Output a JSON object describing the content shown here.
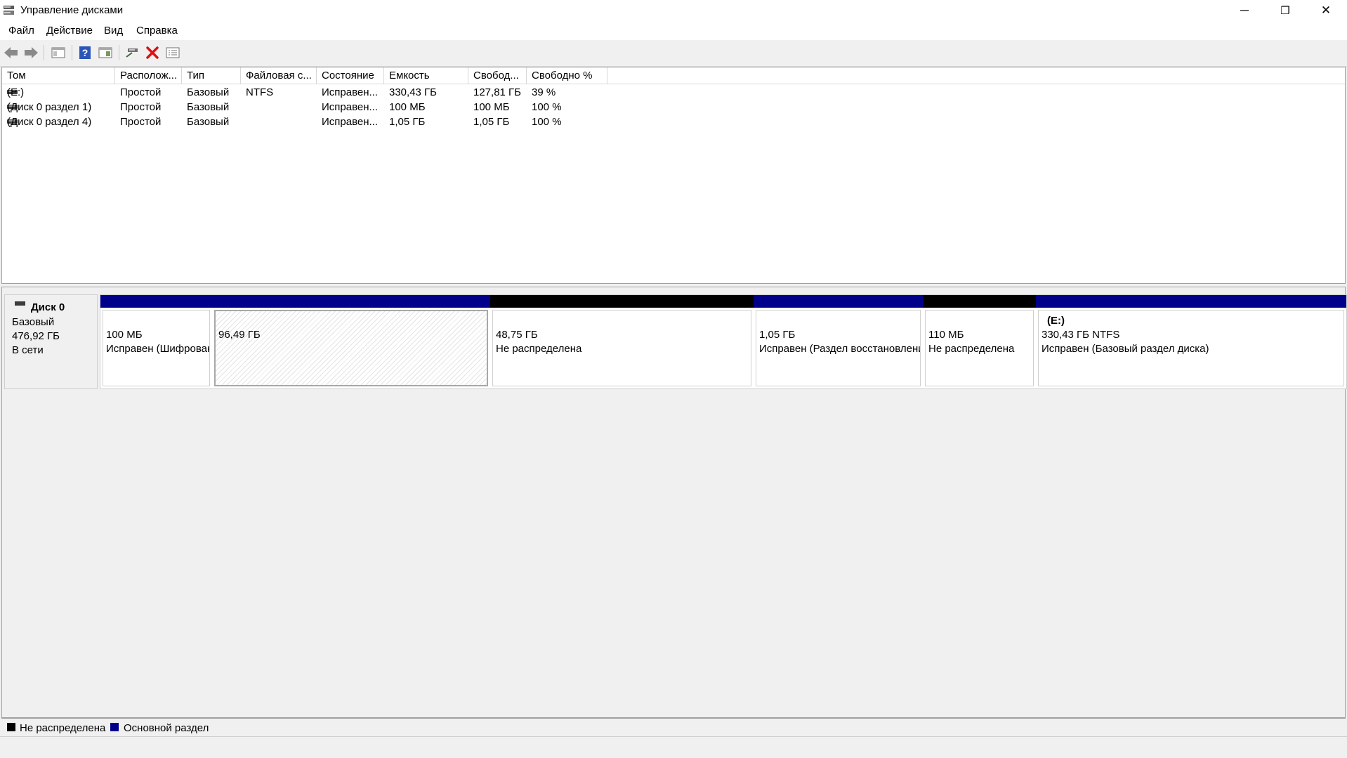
{
  "window": {
    "title": "Управление дисками",
    "minimize_symbol": "─",
    "restore_symbol": "❐",
    "close_symbol": "✕"
  },
  "menu": [
    "Файл",
    "Действие",
    "Вид",
    "Справка"
  ],
  "toolbar": {
    "icons": [
      "back-icon",
      "forward-icon",
      "console-tree-icon",
      "help-icon",
      "properties-view-icon",
      "connect-icon",
      "delete-icon",
      "properties-icon"
    ],
    "delete_color": "#e01010",
    "help_color": "#2c55b8"
  },
  "volume_list": {
    "columns": [
      "Том",
      "Располож...",
      "Тип",
      "Файловая с...",
      "Состояние",
      "Емкость",
      "Свобод...",
      "Свободно %"
    ],
    "rows": [
      [
        "(E:)",
        "Простой",
        "Базовый",
        "NTFS",
        "Исправен...",
        "330,43 ГБ",
        "127,81 ГБ",
        "39 %"
      ],
      [
        "(Диск 0 раздел 1)",
        "Простой",
        "Базовый",
        "",
        "Исправен...",
        "100 МБ",
        "100 МБ",
        "100 %"
      ],
      [
        "(Диск 0 раздел 4)",
        "Простой",
        "Базовый",
        "",
        "Исправен...",
        "1,05 ГБ",
        "1,05 ГБ",
        "100 %"
      ]
    ]
  },
  "disk": {
    "name": "Диск 0",
    "type": "Базовый",
    "size": "476,92 ГБ",
    "status": "В сети",
    "partitions": [
      {
        "kind": "primary",
        "bar_color": "#00008b",
        "label": "",
        "size": "100 МБ",
        "status": "Исправен (Шифрованный (EFI) системный раздел)",
        "hatched": false
      },
      {
        "kind": "primary",
        "bar_color": "#00008b",
        "label": "",
        "size": "96,49 ГБ",
        "status": "",
        "hatched": true
      },
      {
        "kind": "unallocated",
        "bar_color": "#000000",
        "label": "",
        "size": "48,75 ГБ",
        "status": "Не распределена",
        "hatched": false
      },
      {
        "kind": "primary",
        "bar_color": "#00008b",
        "label": "",
        "size": "1,05 ГБ",
        "status": "Исправен (Раздел восстановления)",
        "hatched": false
      },
      {
        "kind": "unallocated",
        "bar_color": "#000000",
        "label": "",
        "size": "110 МБ",
        "status": "Не распределена",
        "hatched": false
      },
      {
        "kind": "primary",
        "bar_color": "#00008b",
        "label": "(E:)",
        "size": "330,43 ГБ NTFS",
        "status": "Исправен (Базовый раздел диска)",
        "hatched": false
      }
    ]
  },
  "legend": [
    {
      "label": "Не распределена",
      "color": "#000000"
    },
    {
      "label": "Основной раздел",
      "color": "#00008b"
    }
  ]
}
